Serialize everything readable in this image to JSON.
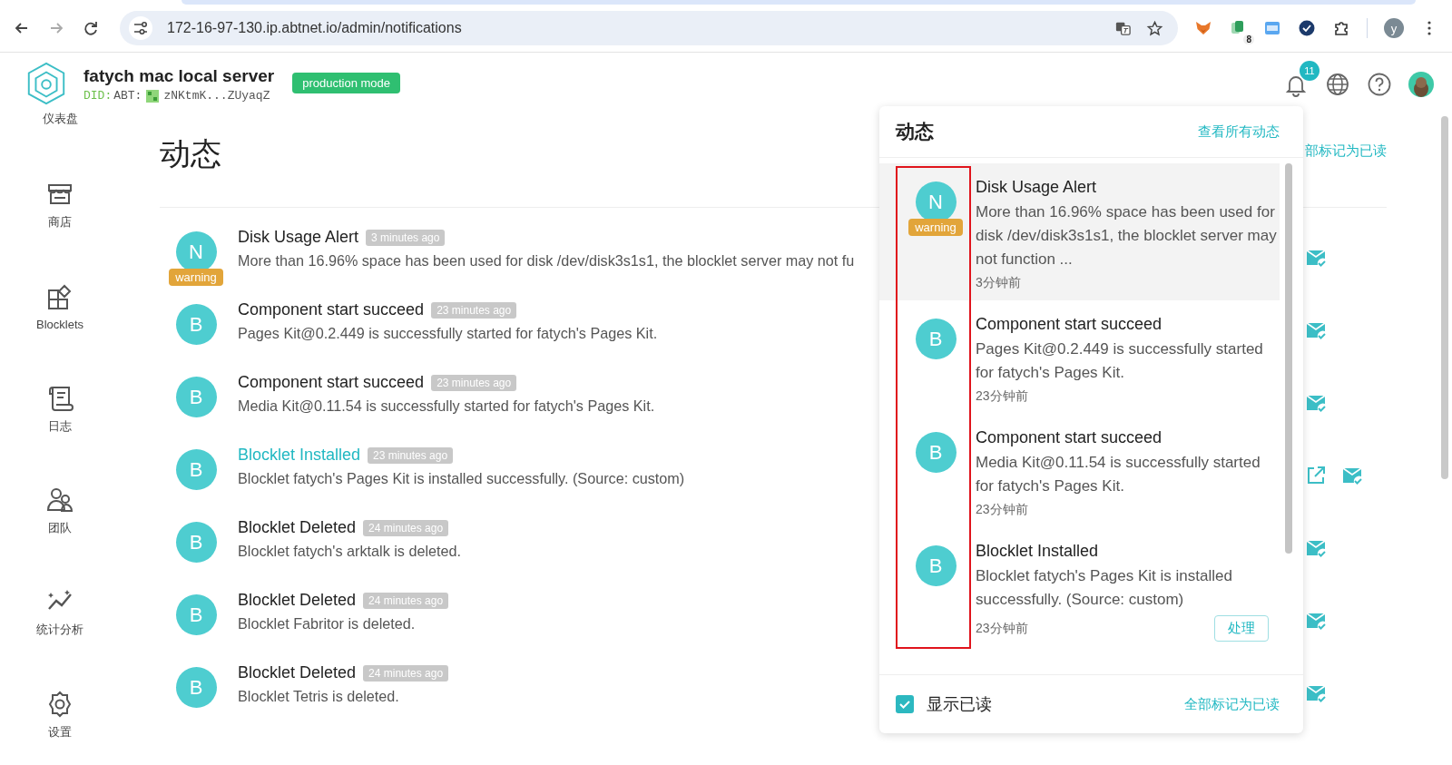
{
  "browser": {
    "url": "172-16-97-130.ip.abtnet.io/admin/notifications",
    "extension_badge": "8",
    "profile": "y"
  },
  "header": {
    "title": "fatych mac local server",
    "did_prefix": "DID:",
    "did_scheme": "ABT:",
    "did": "zNKtmK...ZUyaqZ",
    "mode": "production mode",
    "notification_count": "11"
  },
  "sidebar": {
    "items": [
      {
        "label": "仪表盘",
        "kind": "dashboard"
      },
      {
        "label": "商店",
        "kind": "store"
      },
      {
        "label": "Blocklets",
        "kind": "blocklets"
      },
      {
        "label": "日志",
        "kind": "logs"
      },
      {
        "label": "团队",
        "kind": "team"
      },
      {
        "label": "统计分析",
        "kind": "analytics"
      },
      {
        "label": "设置",
        "kind": "settings"
      }
    ]
  },
  "main": {
    "title": "动态",
    "mark_all": "部标记为已读",
    "notifications": [
      {
        "avatar": "N",
        "tag": "warning",
        "title": "Disk Usage Alert",
        "time": "3 minutes ago",
        "description": "More than 16.96% space has been used for disk /dev/disk3s1s1, the blocklet server may not fu",
        "hovered": false,
        "can_open": false
      },
      {
        "avatar": "B",
        "title": "Component start succeed",
        "time": "23 minutes ago",
        "description": "Pages Kit@0.2.449 is successfully started for fatych's Pages Kit.",
        "hovered": false,
        "can_open": false
      },
      {
        "avatar": "B",
        "title": "Component start succeed",
        "time": "23 minutes ago",
        "description": "Media Kit@0.11.54 is successfully started for fatych's Pages Kit.",
        "hovered": false,
        "can_open": false
      },
      {
        "avatar": "B",
        "title": "Blocklet Installed",
        "time": "23 minutes ago",
        "description": "Blocklet fatych's Pages Kit is installed successfully. (Source: custom)",
        "hovered": true,
        "can_open": true
      },
      {
        "avatar": "B",
        "title": "Blocklet Deleted",
        "time": "24 minutes ago",
        "description": "Blocklet fatych's arktalk is deleted.",
        "hovered": false,
        "can_open": false
      },
      {
        "avatar": "B",
        "title": "Blocklet Deleted",
        "time": "24 minutes ago",
        "description": "Blocklet Fabritor is deleted.",
        "hovered": false,
        "can_open": false
      },
      {
        "avatar": "B",
        "title": "Blocklet Deleted",
        "time": "24 minutes ago",
        "description": "Blocklet Tetris is deleted.",
        "hovered": false,
        "can_open": false
      }
    ]
  },
  "panel": {
    "title": "动态",
    "view_all": "查看所有动态",
    "items": [
      {
        "avatar": "N",
        "tag": "warning",
        "title": "Disk Usage Alert",
        "description": "More than 16.96% space has been used for disk /dev/disk3s1s1, the blocklet server may not function ...",
        "time": "3分钟前",
        "selected": true
      },
      {
        "avatar": "B",
        "title": "Component start succeed",
        "description": "Pages Kit@0.2.449 is successfully started for fatych's Pages Kit.",
        "time": "23分钟前",
        "selected": false
      },
      {
        "avatar": "B",
        "title": "Component start succeed",
        "description": "Media Kit@0.11.54 is successfully started for fatych's Pages Kit.",
        "time": "23分钟前",
        "selected": false
      },
      {
        "avatar": "B",
        "title": "Blocklet Installed",
        "description": "Blocklet fatych's Pages Kit is installed successfully. (Source: custom)",
        "time": "23分钟前",
        "action": "处理",
        "selected": false
      }
    ],
    "show_read": {
      "label": "显示已读",
      "checked": true
    },
    "mark_all": "全部标记为已读"
  }
}
